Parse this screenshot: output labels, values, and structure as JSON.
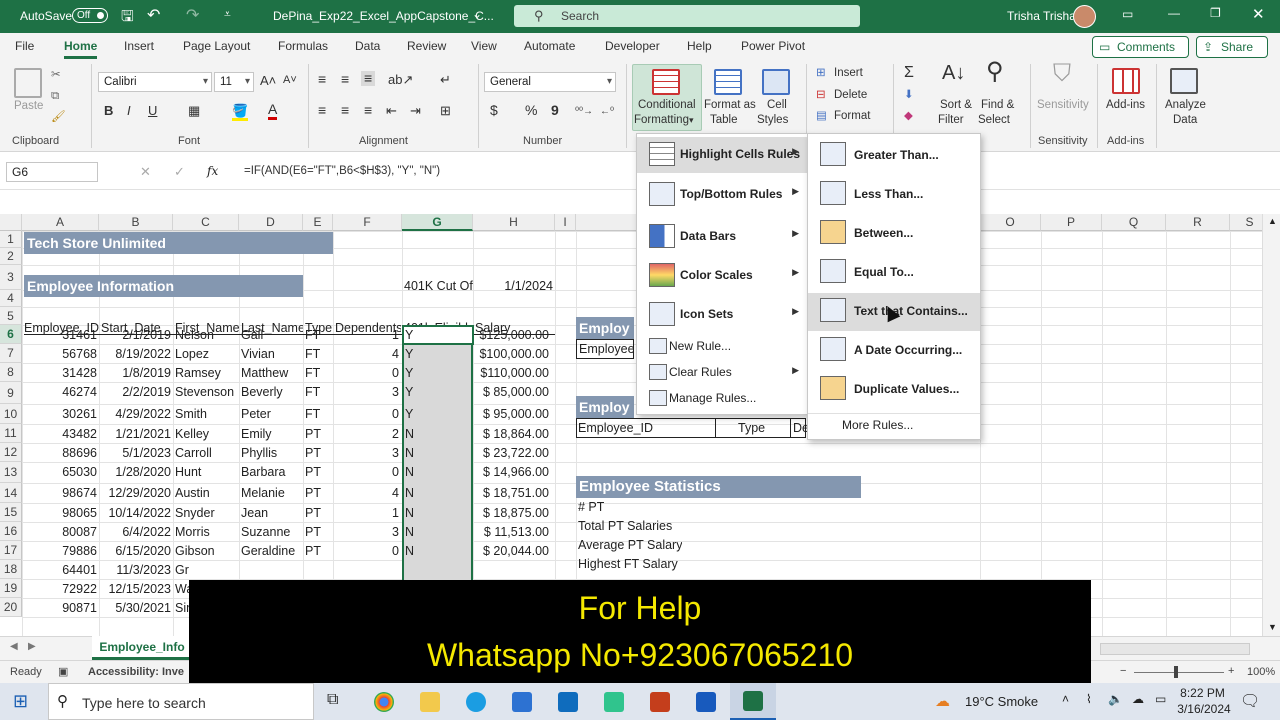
{
  "titlebar": {
    "autosave_label": "AutoSave",
    "autosave_state": "Off",
    "filename": "DePina_Exp22_Excel_AppCapstone_C...",
    "search_placeholder": "Search",
    "user": "Trisha Trisha"
  },
  "tabs": [
    "File",
    "Home",
    "Insert",
    "Page Layout",
    "Formulas",
    "Data",
    "Review",
    "View",
    "Automate",
    "Developer",
    "Help",
    "Power Pivot"
  ],
  "tab_buttons": {
    "comments": "Comments",
    "share": "Share"
  },
  "ribbon": {
    "clipboard": {
      "paste": "Paste",
      "group": "Clipboard"
    },
    "font": {
      "name": "Calibri",
      "size": "11",
      "bold": "B",
      "italic": "I",
      "underline": "U",
      "group": "Font"
    },
    "alignment": {
      "group": "Alignment"
    },
    "number": {
      "format": "General",
      "currency": "$",
      "percent": "%",
      "comma": "9",
      "group": "Number"
    },
    "styles": {
      "cond_format_1": "Conditional",
      "cond_format_2": "Formatting",
      "format_table_1": "Format as",
      "format_table_2": "Table",
      "cell_styles_1": "Cell",
      "cell_styles_2": "Styles"
    },
    "cells": {
      "insert": "Insert",
      "delete": "Delete",
      "format": "Format"
    },
    "editing": {
      "sort_1": "Sort &",
      "sort_2": "Filter",
      "find_1": "Find &",
      "find_2": "Select"
    },
    "sensitivity": {
      "label": "Sensitivity",
      "group": "Sensitivity"
    },
    "addins": {
      "label": "Add-ins",
      "group": "Add-ins"
    },
    "analyze": {
      "label_1": "Analyze",
      "label_2": "Data"
    }
  },
  "formula_bar": {
    "name_box": "G6",
    "fx": "fx",
    "formula": "=IF(AND(E6=\"FT\",B6<$H$3), \"Y\", \"N\")"
  },
  "columns": [
    "A",
    "B",
    "C",
    "D",
    "E",
    "F",
    "G",
    "H",
    "I",
    "O",
    "P",
    "Q",
    "R",
    "S"
  ],
  "row_numbers": [
    "1",
    "2",
    "3",
    "4",
    "5",
    "6",
    "7",
    "8",
    "9",
    "10",
    "11",
    "12",
    "13",
    "14",
    "15",
    "16",
    "17",
    "18",
    "19",
    "20"
  ],
  "sheet": {
    "title": "Tech Store Unlimited",
    "subtitle": "Employee Information",
    "cutoff_label": "401K Cut Of",
    "cutoff_value": "1/1/2024",
    "headers": [
      "Employee_ID",
      "Start_Date",
      "First_Name",
      "Last_Name",
      "Type",
      "Dependents",
      "401k Eligible",
      "Salary"
    ],
    "rows": [
      [
        "31461",
        "2/1/2019",
        "Nelson",
        "Gail",
        "FT",
        "1",
        "Y",
        "$125,000.00"
      ],
      [
        "56768",
        "8/19/2022",
        "Lopez",
        "Vivian",
        "FT",
        "4",
        "Y",
        "$100,000.00"
      ],
      [
        "31428",
        "1/8/2019",
        "Ramsey",
        "Matthew",
        "FT",
        "0",
        "Y",
        "$110,000.00"
      ],
      [
        "46274",
        "2/2/2019",
        "Stevenson",
        "Beverly",
        "FT",
        "3",
        "Y",
        "$ 85,000.00"
      ],
      [
        "30261",
        "4/29/2022",
        "Smith",
        "Peter",
        "FT",
        "0",
        "Y",
        "$ 95,000.00"
      ],
      [
        "43482",
        "1/21/2021",
        "Kelley",
        "Emily",
        "PT",
        "2",
        "N",
        "$ 18,864.00"
      ],
      [
        "88696",
        "5/1/2023",
        "Carroll",
        "Phyllis",
        "PT",
        "3",
        "N",
        "$ 23,722.00"
      ],
      [
        "65030",
        "1/28/2020",
        "Hunt",
        "Barbara",
        "PT",
        "0",
        "N",
        "$ 14,966.00"
      ],
      [
        "98674",
        "12/29/2020",
        "Austin",
        "Melanie",
        "PT",
        "4",
        "N",
        "$ 18,751.00"
      ],
      [
        "98065",
        "10/14/2022",
        "Snyder",
        "Jean",
        "PT",
        "1",
        "N",
        "$ 18,875.00"
      ],
      [
        "80087",
        "6/4/2022",
        "Morris",
        "Suzanne",
        "PT",
        "3",
        "N",
        "$ 11,513.00"
      ],
      [
        "79886",
        "6/15/2020",
        "Gibson",
        "Geraldine",
        "PT",
        "0",
        "N",
        "$ 20,044.00"
      ],
      [
        "64401",
        "11/3/2023",
        "Gr",
        "",
        "",
        "",
        "",
        ""
      ],
      [
        "72922",
        "12/15/2023",
        "Wa",
        "",
        "",
        "",
        "",
        ""
      ],
      [
        "90871",
        "5/30/2021",
        "Sin",
        "",
        "",
        "",
        "",
        ""
      ]
    ],
    "right_band_1": "Employ",
    "right_cell_1": "Employee",
    "right_band_2": "Employ",
    "lookup_headers": [
      "Employee_ID",
      "Type",
      "De"
    ],
    "stats_title": "Employee Statistics",
    "stats": [
      "# PT",
      "Total PT Salaries",
      "Average PT Salary",
      "Highest FT Salary"
    ]
  },
  "cf_menu": {
    "items": [
      "Highlight Cells Rules",
      "Top/Bottom Rules",
      "Data Bars",
      "Color Scales",
      "Icon Sets",
      "New Rule...",
      "Clear Rules",
      "Manage Rules..."
    ]
  },
  "highlight_menu": {
    "items": [
      "Greater Than...",
      "Less Than...",
      "Between...",
      "Equal To...",
      "Text that Contains...",
      "A Date Occurring...",
      "Duplicate Values..."
    ],
    "more": "More Rules..."
  },
  "sheet_tab": "Employee_Info",
  "status": {
    "ready": "Ready",
    "accessibility": "Accessibility: Inve",
    "zoom": "100%"
  },
  "taskbar": {
    "search_placeholder": "Type here to search",
    "weather": "19°C  Smoke",
    "time": "8:22 PM",
    "date": "3/16/2024"
  },
  "overlay": {
    "line1": "For Help",
    "line2": "Whatsapp No+923067065210"
  },
  "colors": {
    "excel_green": "#1e7145",
    "band_blue": "#8497b0",
    "overlay_text": "#f4e800"
  }
}
